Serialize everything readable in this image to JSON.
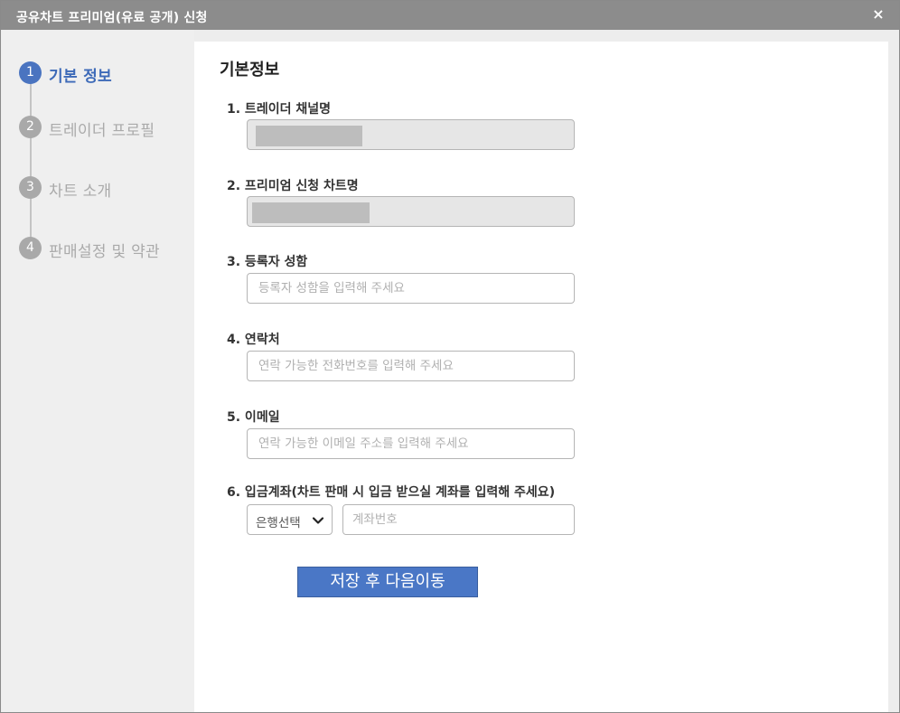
{
  "window": {
    "title": "공유차트 프리미엄(유료 공개) 신청",
    "close_label": "×"
  },
  "steps": [
    {
      "num": "1",
      "label": "기본 정보",
      "active": true
    },
    {
      "num": "2",
      "label": "트레이더 프로필",
      "active": false
    },
    {
      "num": "3",
      "label": "차트 소개",
      "active": false
    },
    {
      "num": "4",
      "label": "판매설정 및 약관",
      "active": false
    }
  ],
  "form": {
    "section_title": "기본정보",
    "channel_label": "1. 트레이더 채널명",
    "chart_name_label": "2. 프리미엄 신청 차트명",
    "name_label": "3. 등록자 성함",
    "name_placeholder": "등록자 성함을 입력해 주세요",
    "phone_label": "4. 연락처",
    "phone_placeholder": "연락 가능한 전화번호를 입력해 주세요",
    "email_label": "5. 이메일",
    "email_placeholder": "연락 가능한 이메일 주소를 입력해 주세요",
    "account_label": "6. 입금계좌(차트 판매 시 입금 받으실 계좌를 입력해 주세요)",
    "bank_select_value": "은행선택",
    "account_placeholder": "계좌번호",
    "submit_label": "저장 후 다음이동"
  },
  "colors": {
    "accent": "#4a77c6",
    "active_step": "#3d6ab8",
    "titlebar": "#8c8c8c"
  }
}
